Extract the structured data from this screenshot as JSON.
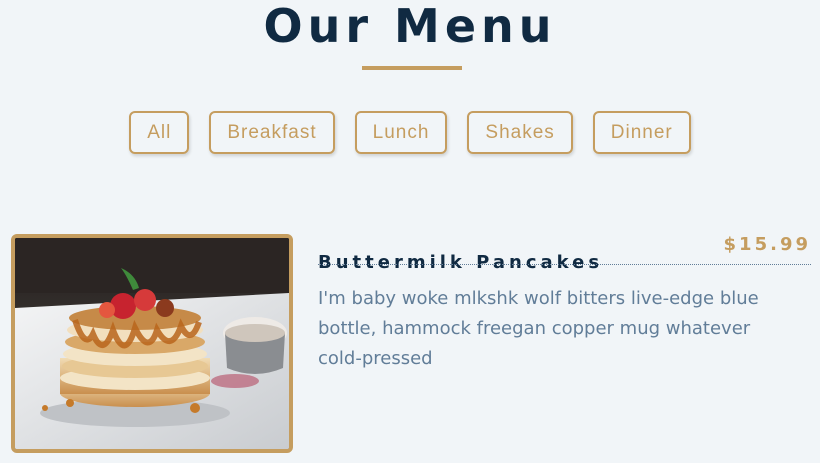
{
  "header": {
    "title": "Our Menu"
  },
  "filters": [
    {
      "label": "All"
    },
    {
      "label": "Breakfast"
    },
    {
      "label": "Lunch"
    },
    {
      "label": "Shakes"
    },
    {
      "label": "Dinner"
    }
  ],
  "menu_items": [
    {
      "title": "Buttermilk Pancakes",
      "price": "$15.99",
      "description": "I'm baby woke mlkshk wolf bitters live-edge blue bottle, hammock freegan copper mug whatever cold-pressed",
      "image": "pancakes-photo"
    }
  ],
  "colors": {
    "background": "#f1f5f8",
    "accent": "#c59d5f",
    "heading": "#102a42",
    "body_text": "#617d98"
  }
}
